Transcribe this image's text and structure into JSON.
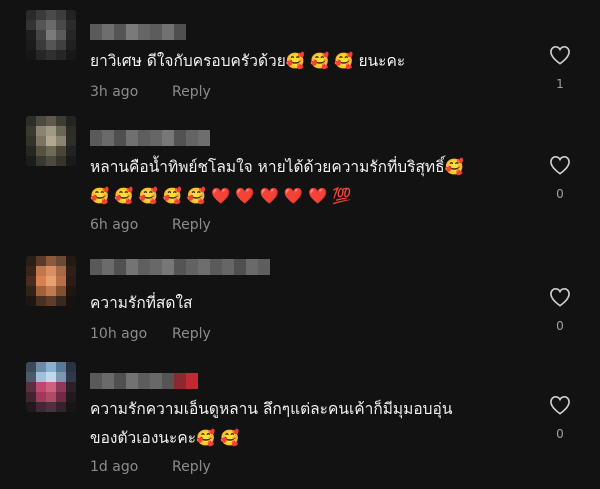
{
  "comments": [
    {
      "text": "ยาวิเศษ ดีใจกับครอบครัวด้วย🥰 🥰 🥰 ยนะคะ",
      "time": "3h ago",
      "reply_label": "Reply",
      "like_count": "1",
      "heart_icon": "heart-outline-icon"
    },
    {
      "text": "หลานคือน้ำทิพย์ชโลมใจ หายได้ด้วยความรักที่บริสุทธิ์🥰\n🥰 🥰 🥰 🥰 🥰 ❤️ ❤️ ❤️ ❤️ ❤️ 💯",
      "time": "6h ago",
      "reply_label": "Reply",
      "like_count": "0",
      "heart_icon": "heart-outline-icon"
    },
    {
      "text": "ความรักที่สดใส",
      "time": "10h ago",
      "reply_label": "Reply",
      "like_count": "0",
      "heart_icon": "heart-outline-icon"
    },
    {
      "text": "ความรักความเอ็นดูหลาน ลึกๆแต่ละคนเค้าก็มีมุมอบอุ่น\nของตัวเองนะคะ🥰 🥰",
      "time": "1d ago",
      "reply_label": "Reply",
      "like_count": "0",
      "heart_icon": "heart-outline-icon"
    }
  ],
  "colors": {
    "background": "#121212",
    "text": "#f2f2f2",
    "meta": "#8c8c8c"
  }
}
